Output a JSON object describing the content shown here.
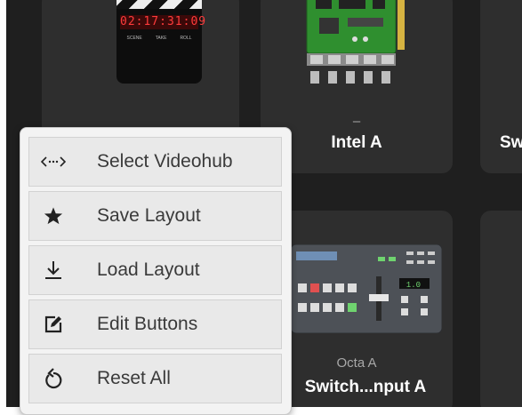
{
  "tiles": [
    {
      "subtitle": "–",
      "title": ""
    },
    {
      "subtitle": "–",
      "title": "Intel A"
    },
    {
      "subtitle": "",
      "title": "Sw"
    },
    {
      "subtitle": "Octa A",
      "title": "Switch...nput A"
    }
  ],
  "clapper": {
    "timecode": "02:17:31:09",
    "labels": [
      "SCENE",
      "TAKE",
      "ROLL"
    ]
  },
  "menu": {
    "items": [
      {
        "label": "Select Videohub",
        "icon": "arrows-icon"
      },
      {
        "label": "Save Layout",
        "icon": "star-icon"
      },
      {
        "label": "Load Layout",
        "icon": "download-icon"
      },
      {
        "label": "Edit Buttons",
        "icon": "edit-icon"
      },
      {
        "label": "Reset All",
        "icon": "reset-icon"
      }
    ]
  },
  "switcher": {
    "display": "1.0"
  }
}
